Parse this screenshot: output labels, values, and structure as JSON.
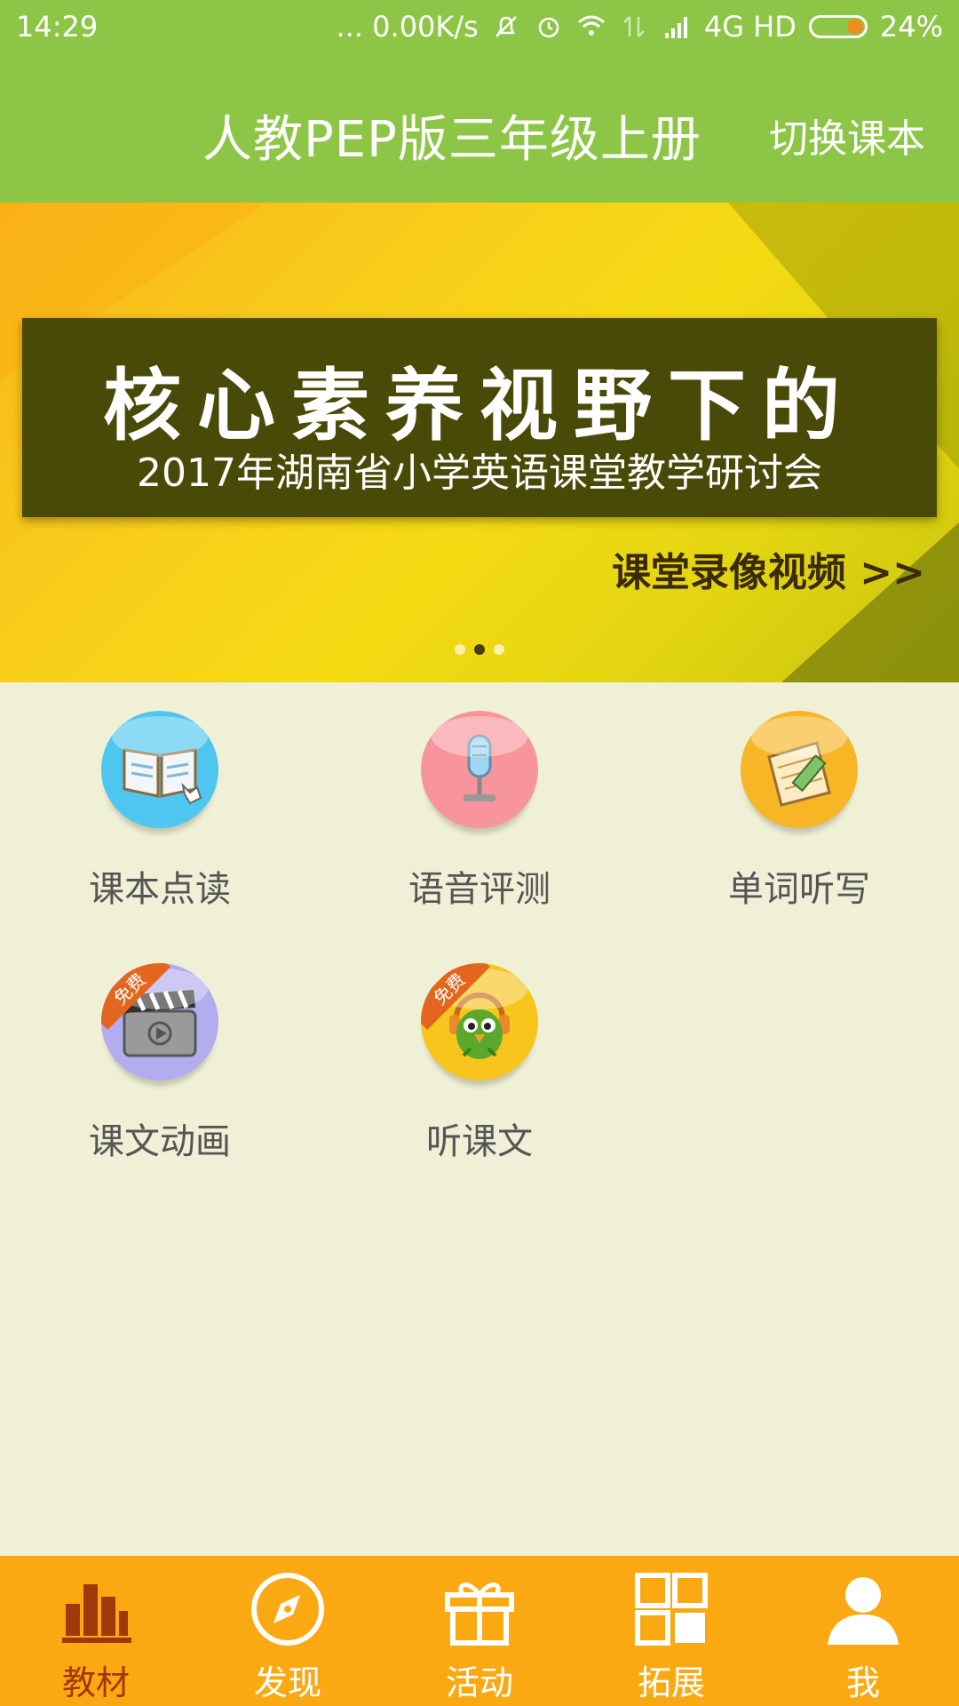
{
  "status_bar": {
    "time": "14:29",
    "network_speed": "... 0.00K/s",
    "network_type": "4G HD",
    "battery": "24%"
  },
  "header": {
    "title": "人教PEP版三年级上册",
    "switch_label": "切换课本"
  },
  "banner": {
    "headline": "核心素养视野下的",
    "subtitle": "2017年湖南省小学英语课堂教学研讨会",
    "link_text": "课堂录像视频 >>",
    "page_count": 3,
    "active_index": 1
  },
  "features": [
    {
      "label": "课本点读",
      "icon": "open-book-icon",
      "color": "#4FC6F0",
      "free": false
    },
    {
      "label": "语音评测",
      "icon": "microphone-icon",
      "color": "#F8949B",
      "free": false
    },
    {
      "label": "单词听写",
      "icon": "notepad-pencil-icon",
      "color": "#F7B625",
      "free": false
    },
    {
      "label": "课文动画",
      "icon": "clapperboard-icon",
      "color": "#B3ADEF",
      "free": true,
      "free_badge": "免费"
    },
    {
      "label": "听课文",
      "icon": "parrot-headphones-icon",
      "color": "#F8C51C",
      "free": true,
      "free_badge": "免费"
    }
  ],
  "tabs": [
    {
      "label": "教材",
      "icon": "bar-chart-icon",
      "active": true
    },
    {
      "label": "发现",
      "icon": "compass-icon",
      "active": false
    },
    {
      "label": "活动",
      "icon": "gift-icon",
      "active": false
    },
    {
      "label": "拓展",
      "icon": "grid-icon",
      "active": false
    },
    {
      "label": "我",
      "icon": "person-icon",
      "active": false
    }
  ],
  "colors": {
    "header": "#8DC646",
    "tabbar": "#FBA912",
    "tab_active": "#A3370C",
    "page_bg": "#F0F0D7"
  }
}
